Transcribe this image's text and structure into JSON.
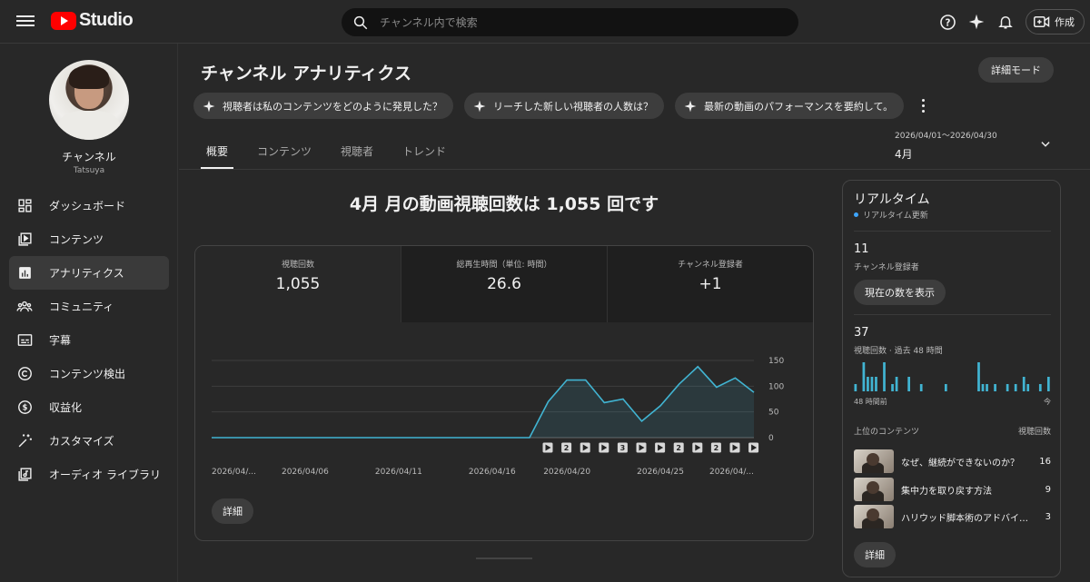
{
  "app": {
    "logo_text": "Studio"
  },
  "search": {
    "placeholder": "チャンネル内で検索"
  },
  "header": {
    "create_label": "作成"
  },
  "sidebar": {
    "channel_name": "チャンネル",
    "channel_handle": "Tatsuya",
    "items": [
      {
        "label": "ダッシュボード",
        "icon": "dashboard-icon"
      },
      {
        "label": "コンテンツ",
        "icon": "content-icon"
      },
      {
        "label": "アナリティクス",
        "icon": "analytics-icon",
        "active": true
      },
      {
        "label": "コミュニティ",
        "icon": "community-icon"
      },
      {
        "label": "字幕",
        "icon": "subtitles-icon"
      },
      {
        "label": "コンテンツ検出",
        "icon": "copyright-icon"
      },
      {
        "label": "収益化",
        "icon": "monetization-icon"
      },
      {
        "label": "カスタマイズ",
        "icon": "customization-icon"
      },
      {
        "label": "オーディオ ライブラリ",
        "icon": "audio-library-icon"
      }
    ]
  },
  "page": {
    "title": "チャンネル アナリティクス",
    "detail_mode_label": "詳細モード",
    "chips": [
      "視聴者は私のコンテンツをどのように発見した？",
      "リーチした新しい視聴者の人数は？",
      "最新の動画のパフォーマンスを要約して。"
    ],
    "tabs": [
      "概要",
      "コンテンツ",
      "視聴者",
      "トレンド"
    ],
    "date_range": "2026/04/01～2026/04/30",
    "date_label": "4月",
    "headline": "4月 月の動画視聴回数は 1,055 回です"
  },
  "metrics": [
    {
      "label": "視聴回数",
      "value": "1,055"
    },
    {
      "label": "総再生時間（単位: 時間）",
      "value": "26.6"
    },
    {
      "label": "チャンネル登録者",
      "value": "+1"
    }
  ],
  "chart_data": {
    "type": "area",
    "x": [
      "2026/04/01",
      "2026/04/02",
      "2026/04/03",
      "2026/04/04",
      "2026/04/05",
      "2026/04/06",
      "2026/04/07",
      "2026/04/08",
      "2026/04/09",
      "2026/04/10",
      "2026/04/11",
      "2026/04/12",
      "2026/04/13",
      "2026/04/14",
      "2026/04/15",
      "2026/04/16",
      "2026/04/17",
      "2026/04/18",
      "2026/04/19",
      "2026/04/20",
      "2026/04/21",
      "2026/04/22",
      "2026/04/23",
      "2026/04/24",
      "2026/04/25",
      "2026/04/26",
      "2026/04/27",
      "2026/04/28",
      "2026/04/29",
      "2026/04/30"
    ],
    "values": [
      0,
      0,
      0,
      0,
      0,
      0,
      0,
      0,
      0,
      0,
      0,
      0,
      0,
      0,
      0,
      0,
      0,
      0,
      70,
      112,
      112,
      68,
      75,
      32,
      62,
      104,
      138,
      98,
      116,
      88
    ],
    "xtick_labels": [
      "2026/04/...",
      "2026/04/06",
      "2026/04/11",
      "2026/04/16",
      "2026/04/20",
      "2026/04/25",
      "2026/04/..."
    ],
    "yticks": [
      0,
      50,
      100,
      150
    ],
    "ylim": [
      0,
      150
    ],
    "color": "#41b4d2",
    "markers": [
      "play",
      "2",
      "play",
      "play",
      "3",
      "play",
      "play",
      "2",
      "play",
      "2",
      "play",
      "play"
    ]
  },
  "details_label": "詳細",
  "realtime": {
    "title": "リアルタイム",
    "live_label": "リアルタイム更新",
    "subscribers_value": "11",
    "subscribers_label": "チャンネル登録者",
    "show_count_label": "現在の数を表示",
    "views_value": "37",
    "views_label": "視聴回数 · 過去 48 時間",
    "axis_start": "48 時間前",
    "axis_end": "今",
    "bars": [
      1,
      0,
      4,
      2,
      2,
      2,
      0,
      4,
      0,
      1,
      2,
      0,
      0,
      2,
      0,
      0,
      1,
      0,
      0,
      0,
      0,
      0,
      1,
      0,
      0,
      0,
      0,
      0,
      0,
      0,
      4,
      1,
      1,
      0,
      1,
      0,
      0,
      1,
      0,
      1,
      0,
      2,
      1,
      0,
      0,
      1,
      0,
      2
    ],
    "top_content_label": "上位のコンテンツ",
    "views_column_label": "視聴回数",
    "top_content": [
      {
        "title": "なぜ、継続ができないのか？",
        "views": "16"
      },
      {
        "title": "集中力を取り戻す方法",
        "views": "9"
      },
      {
        "title": "ハリウッド脚本術のアドバイ…",
        "views": "3"
      }
    ],
    "details_label": "詳細"
  }
}
